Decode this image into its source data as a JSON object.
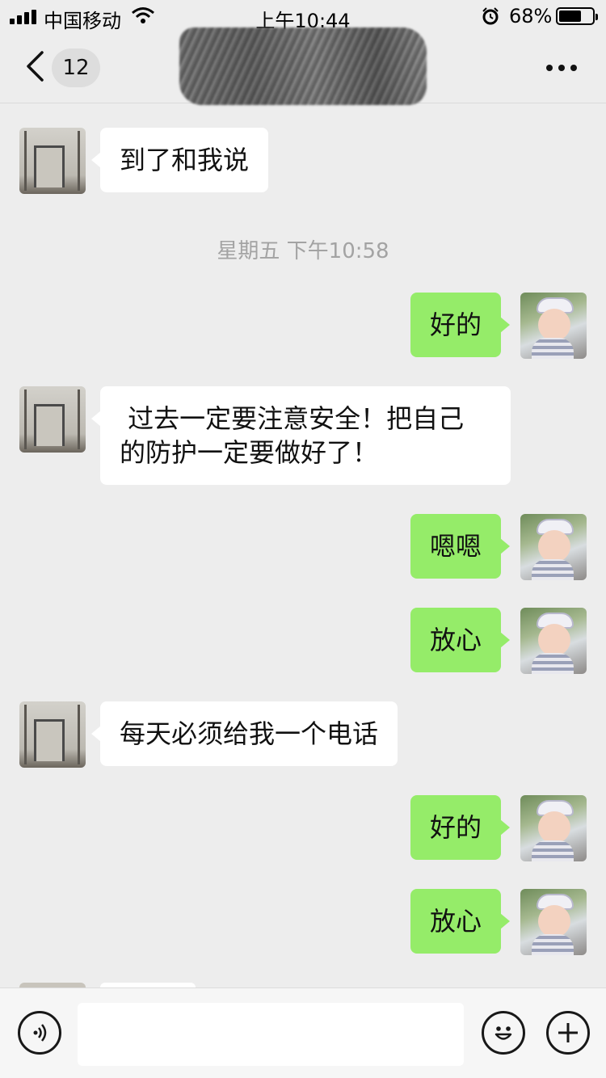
{
  "status_bar": {
    "carrier": "中国移动",
    "time": "上午10:44",
    "battery_percent": "68%",
    "battery_level": 0.68,
    "icons": [
      "signal-icon",
      "wifi-icon",
      "alarm-icon",
      "battery-icon"
    ]
  },
  "nav": {
    "back_icon": "chevron-left-icon",
    "unread_count": "12",
    "title": "",
    "more_icon": "more-dots-icon"
  },
  "messages": [
    {
      "side": "in",
      "text": "到了和我说"
    },
    {
      "side": "out",
      "text": "好的"
    },
    {
      "side": "in",
      "text": " 过去一定要注意安全！把自己\n的防护一定要做好了！"
    },
    {
      "side": "out",
      "text": "嗯嗯"
    },
    {
      "side": "out",
      "text": "放心"
    },
    {
      "side": "in",
      "text": "每天必须给我一个电话"
    },
    {
      "side": "out",
      "text": "好的"
    },
    {
      "side": "out",
      "text": "放心"
    }
  ],
  "timestamp": "星期五 下午10:58",
  "input_bar": {
    "value": "",
    "icons": [
      "voice-icon",
      "emoji-icon",
      "plus-icon"
    ]
  },
  "colors": {
    "background": "#ededed",
    "bubble_out": "#95ec69",
    "bubble_in": "#ffffff",
    "timestamp": "#a3a3a3"
  }
}
